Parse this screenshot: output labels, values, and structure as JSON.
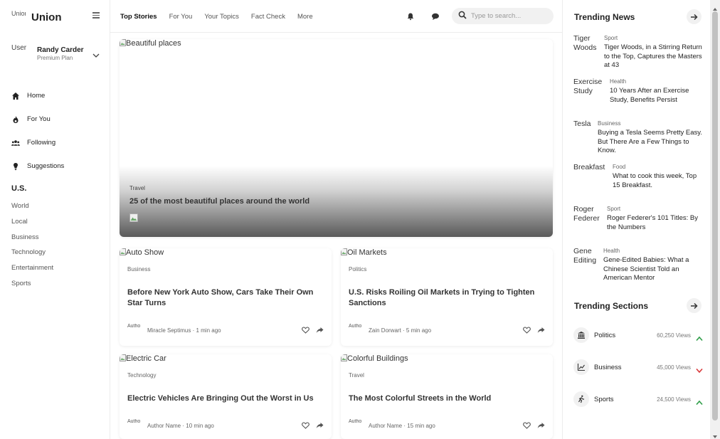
{
  "brand": {
    "logo_alt": "Union",
    "name": "Union"
  },
  "user": {
    "avatar_alt": "User",
    "name": "Randy Carder",
    "plan": "Premium Plan"
  },
  "nav": [
    {
      "label": "Home",
      "icon": "home-icon"
    },
    {
      "label": "For You",
      "icon": "flame-icon"
    },
    {
      "label": "Following",
      "icon": "users-icon"
    },
    {
      "label": "Suggestions",
      "icon": "lightbulb-icon"
    }
  ],
  "region": {
    "title": "U.S.",
    "links": [
      "World",
      "Local",
      "Business",
      "Technology",
      "Entertainment",
      "Sports"
    ]
  },
  "header": {
    "tabs": [
      "Top Stories",
      "For You",
      "Your Topics",
      "Fact Check",
      "More"
    ],
    "active_tab": "Top Stories",
    "search_placeholder": "Type to search..."
  },
  "hero": {
    "image_alt": "Beautiful places",
    "category": "Travel",
    "title": "25 of the most beautiful places around the world"
  },
  "articles": [
    {
      "image_alt": "Auto Show",
      "category": "Business",
      "title": "Before New York Auto Show, Cars Take Their Own Star Turns",
      "avatar_alt": "Author",
      "author": "Miracle Septimus",
      "time": "1 min ago"
    },
    {
      "image_alt": "Oil Markets",
      "category": "Politics",
      "title": "U.S. Risks Roiling Oil Markets in Trying to Tighten Sanctions",
      "avatar_alt": "Author",
      "author": "Zain Dorwart",
      "time": "5 min ago"
    },
    {
      "image_alt": "Electric Car",
      "category": "Technology",
      "title": "Electric Vehicles Are Bringing Out the Worst in Us",
      "avatar_alt": "Author",
      "author": "Author Name",
      "time": "10 min ago"
    },
    {
      "image_alt": "Colorful Buildings",
      "category": "Travel",
      "title": "The Most Colorful Streets in the World",
      "avatar_alt": "Author",
      "author": "Author Name",
      "time": "15 min ago"
    }
  ],
  "trending_news": {
    "title": "Trending News",
    "items": [
      {
        "image_alt": "Tiger Woods",
        "category": "Sport",
        "title": "Tiger Woods, in a Stirring Return to the Top, Captures the Masters at 43"
      },
      {
        "image_alt": "Exercise Study",
        "category": "Health",
        "title": "10 Years After an Exercise Study, Benefits Persist"
      },
      {
        "image_alt": "Tesla",
        "category": "Business",
        "title": "Buying a Tesla Seems Pretty Easy. But There Are a Few Things to Know."
      },
      {
        "image_alt": "Breakfast",
        "category": "Food",
        "title": "What to cook this week, Top 15 Breakfast."
      },
      {
        "image_alt": "Roger Federer",
        "category": "Sport",
        "title": "Roger Federer's 101 Titles: By the Numbers"
      },
      {
        "image_alt": "Gene Editing",
        "category": "Health",
        "title": "Gene-Edited Babies: What a Chinese Scientist Told an American Mentor"
      }
    ]
  },
  "trending_sections": {
    "title": "Trending Sections",
    "items": [
      {
        "name": "Politics",
        "views": "60,250 Views",
        "direction": "up",
        "icon": "bank-icon"
      },
      {
        "name": "Business",
        "views": "45,000 Views",
        "direction": "down",
        "icon": "line-chart-icon"
      },
      {
        "name": "Sports",
        "views": "24,500 Views",
        "direction": "up",
        "icon": "running-icon"
      }
    ]
  },
  "colors": {
    "up": "#2e9e48",
    "down": "#d9383a",
    "search_bg": "#f1f1f1"
  }
}
